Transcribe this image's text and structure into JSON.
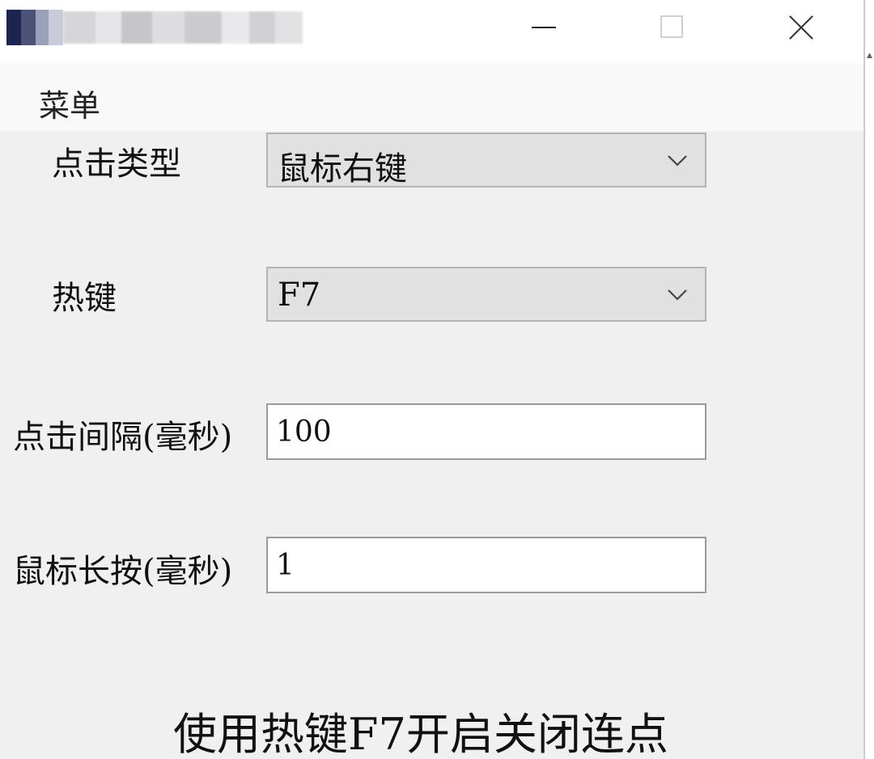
{
  "window": {
    "buttons": {
      "minimize_icon": "minimize-icon",
      "maximize_icon": "maximize-icon",
      "close_icon": "close-icon"
    }
  },
  "menu": {
    "label": "菜单"
  },
  "form": {
    "click_type": {
      "label": "点击类型",
      "value": "鼠标右键"
    },
    "hotkey": {
      "label": "热键",
      "value": "F7"
    },
    "click_interval": {
      "label": "点击间隔(毫秒)",
      "value": "100"
    },
    "mouse_hold": {
      "label": "鼠标长按(毫秒)",
      "value": "1"
    }
  },
  "status": {
    "text": "使用热键F7开启关闭连点"
  }
}
